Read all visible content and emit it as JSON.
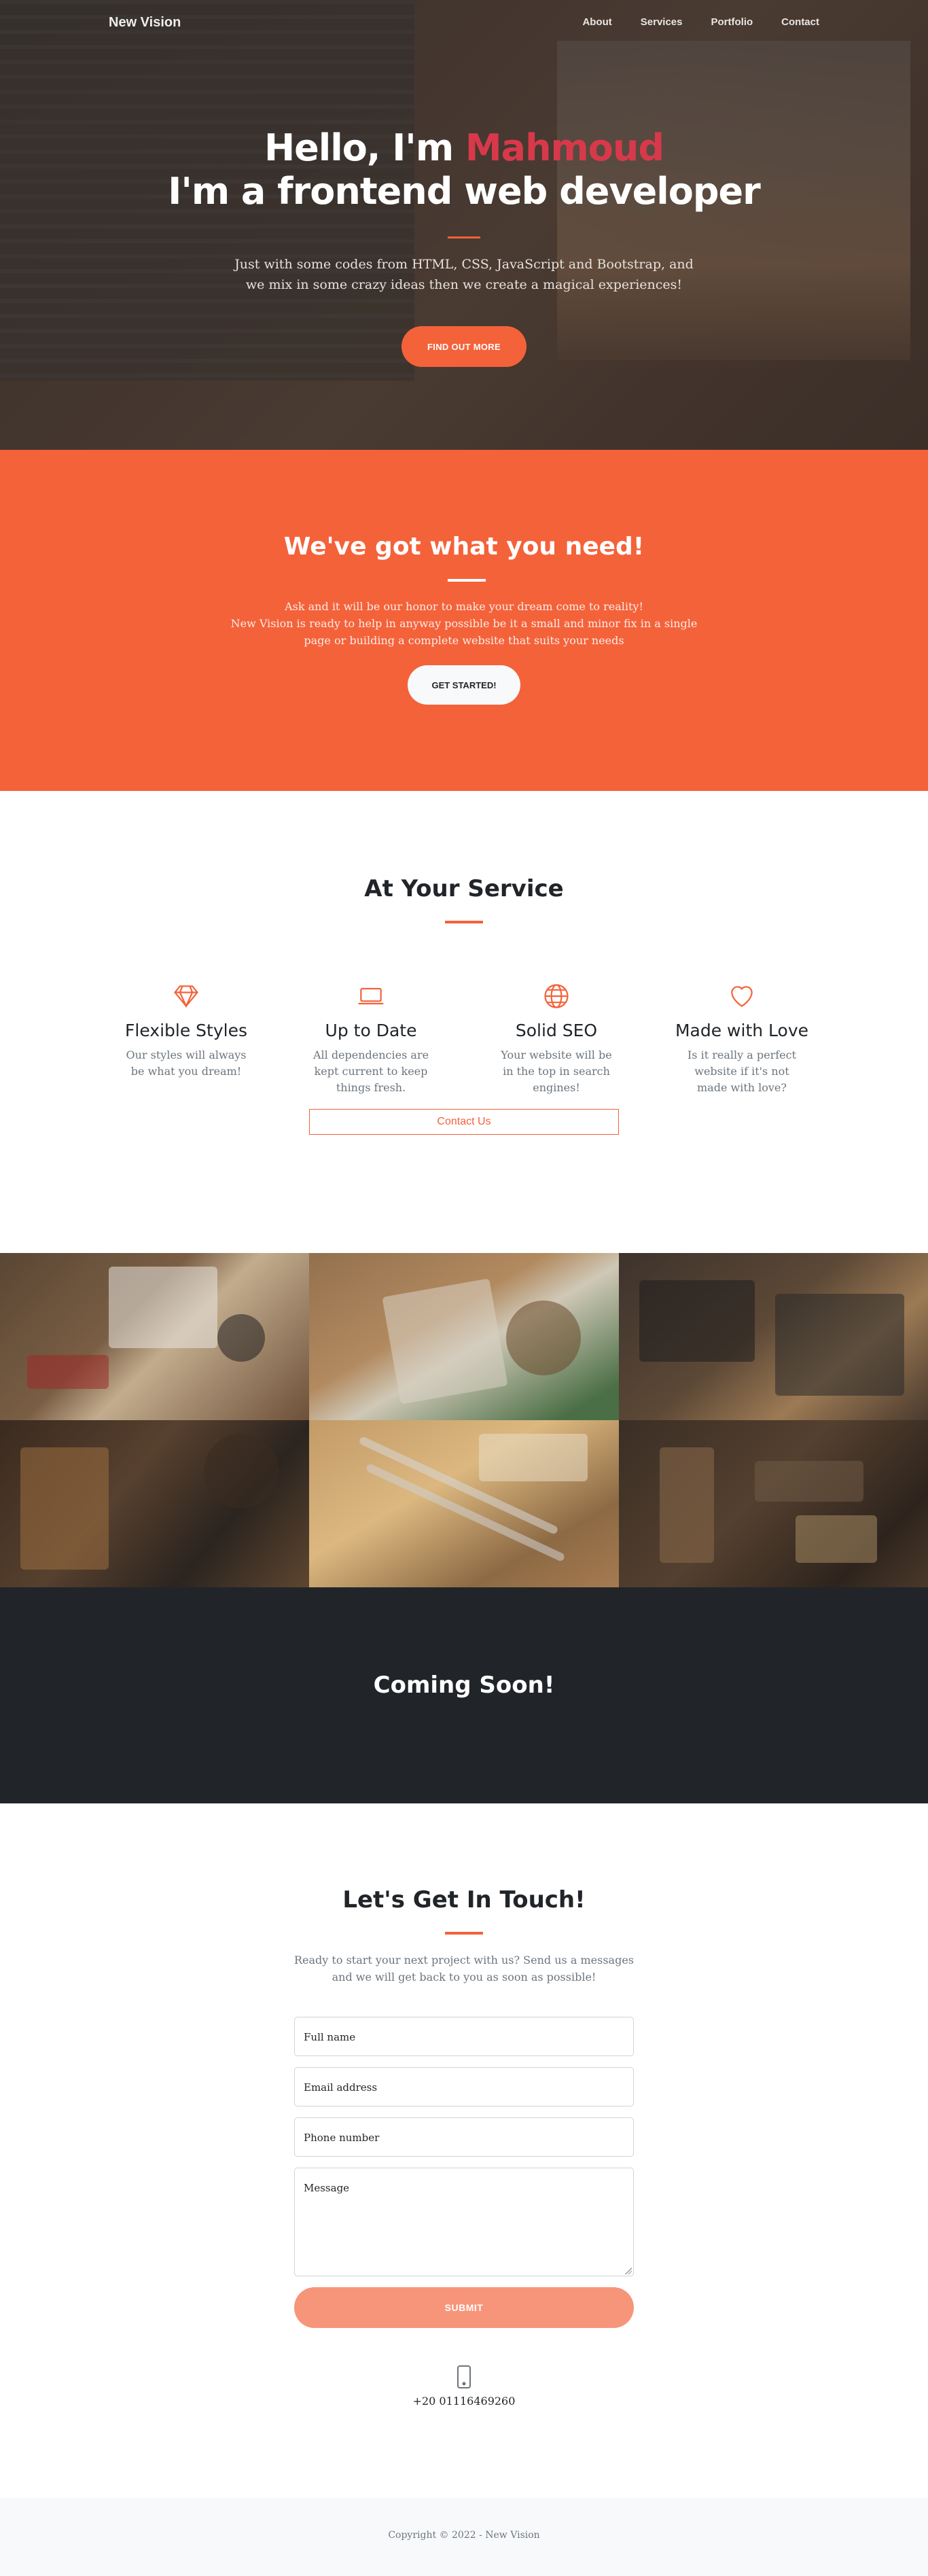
{
  "nav": {
    "brand": "New Vision",
    "links": [
      "About",
      "Services",
      "Portfolio",
      "Contact"
    ]
  },
  "hero": {
    "title_prefix": "Hello, I'm ",
    "title_name": "Mahmoud",
    "title_line2": "I'm a frontend web developer",
    "subtitle": "Just with some codes from HTML, CSS, JavaScript and Bootstrap, and we mix in some crazy ideas then we create a magical experiences!",
    "cta": "FIND OUT MORE"
  },
  "need": {
    "title": "We've got what you need!",
    "text_line1": "Ask and it will be our honor to make your dream come to reality!",
    "text_line2": "New Vision is ready to help in anyway possible be it a small and minor fix in a single page or building a complete website that suits your needs",
    "cta": "GET STARTED!"
  },
  "services": {
    "title": "At Your Service",
    "items": [
      {
        "title": "Flexible Styles",
        "text": "Our styles will always be what you dream!",
        "icon": "gem-icon"
      },
      {
        "title": "Up to Date",
        "text": "All dependencies are kept current to keep things fresh.",
        "icon": "laptop-icon"
      },
      {
        "title": "Solid SEO",
        "text": "Your website will be in the top in search engines!",
        "icon": "globe-icon"
      },
      {
        "title": "Made with Love",
        "text": "Is it really a perfect website if it's not made with love?",
        "icon": "heart-icon"
      }
    ],
    "contact_button": "Contact Us"
  },
  "soon": {
    "title": "Coming Soon!"
  },
  "contact": {
    "title": "Let's Get In Touch!",
    "lead": "Ready to start your next project with us? Send us a messages and we will get back to you as soon as possible!",
    "fields": {
      "name": "Full name",
      "email": "Email address",
      "phone": "Phone number",
      "message": "Message"
    },
    "submit": "SUBMIT",
    "phone_number": "+20 01116469260"
  },
  "footer": {
    "copyright": "Copyright © 2022 - New Vision"
  },
  "colors": {
    "accent": "#f4623a",
    "name_highlight": "#d8394a",
    "dark": "#212529"
  }
}
